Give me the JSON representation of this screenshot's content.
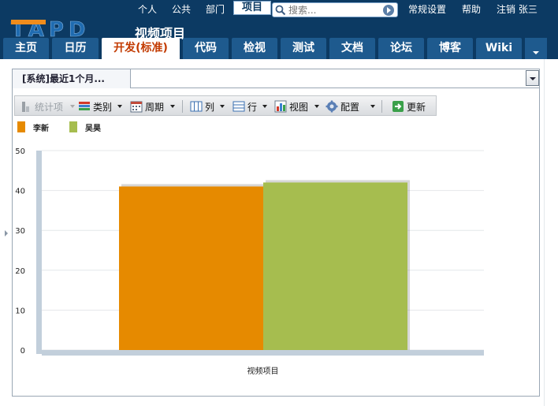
{
  "header": {
    "top_nav": {
      "personal": "个人",
      "public": "公共",
      "department": "部门",
      "project": "项目",
      "settings": "常规设置",
      "help": "帮助",
      "logout": "注销 张三"
    },
    "search": {
      "placeholder": "搜索..."
    },
    "logo_text": "TAPD",
    "project_title": "视频项目",
    "tabs": [
      {
        "label": "主页"
      },
      {
        "label": "日历"
      },
      {
        "label": "开发(标准)"
      },
      {
        "label": "代码"
      },
      {
        "label": "检视"
      },
      {
        "label": "测试"
      },
      {
        "label": "文档"
      },
      {
        "label": "论坛"
      },
      {
        "label": "博客"
      },
      {
        "label": "Wiki"
      }
    ],
    "active_tab": "开发(标准)"
  },
  "panel": {
    "tab_label": "[系统]最近1个月...",
    "toolbar": {
      "stats": "统计项",
      "category": "类别",
      "period": "周期",
      "column": "列",
      "row": "行",
      "view": "视图",
      "config": "配置",
      "refresh": "更新"
    }
  },
  "chart_data": {
    "type": "bar",
    "categories": [
      "视频项目"
    ],
    "series": [
      {
        "name": "李新",
        "values": [
          41
        ],
        "color": "#e68a00"
      },
      {
        "name": "吴昊",
        "values": [
          42
        ],
        "color": "#a6bd4f"
      }
    ],
    "xlabel": "视频项目",
    "ylim": [
      0,
      50
    ],
    "yticks": [
      0,
      10,
      20,
      30,
      40,
      50
    ],
    "grid": true,
    "legend": "top-left"
  }
}
